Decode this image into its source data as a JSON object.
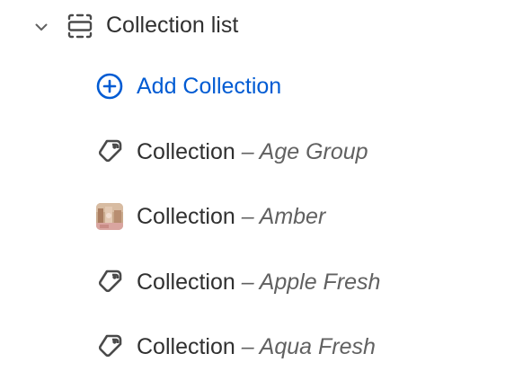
{
  "section": {
    "title": "Collection list",
    "expanded": true
  },
  "add_item": {
    "label": "Add Collection",
    "color": "#005bd3"
  },
  "items": [
    {
      "type_label": "Collection",
      "separator": " – ",
      "name": "Age Group",
      "icon": "tag-icon"
    },
    {
      "type_label": "Collection",
      "separator": " – ",
      "name": "Amber",
      "icon": "collection-thumbnail"
    },
    {
      "type_label": "Collection",
      "separator": " – ",
      "name": "Apple Fresh",
      "icon": "tag-icon"
    },
    {
      "type_label": "Collection",
      "separator": " – ",
      "name": "Aqua Fresh",
      "icon": "tag-icon"
    }
  ]
}
